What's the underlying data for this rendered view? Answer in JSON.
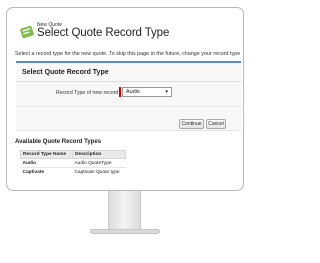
{
  "header": {
    "subtitle": "New Quote",
    "title": "Select Quote Record Type",
    "icon": "quote-icon"
  },
  "intro_text": "Select a record type for the new quote. To skip this page in the future, change your record type",
  "form": {
    "title": "Select Quote Record Type",
    "field_label": "Record Type of new record",
    "selected_value": "Audio",
    "continue_label": "Continue",
    "cancel_label": "Cancel"
  },
  "available": {
    "title": "Available Quote Record Types",
    "columns": [
      "Record Type Name",
      "Description"
    ],
    "rows": [
      {
        "name": "Audio",
        "description": "Audio QuoteType"
      },
      {
        "name": "Captivate",
        "description": "Captivate Quote type"
      }
    ]
  },
  "colors": {
    "accent": "#5a8bc5",
    "required": "#c00000",
    "icon_green": "#6db33f"
  }
}
